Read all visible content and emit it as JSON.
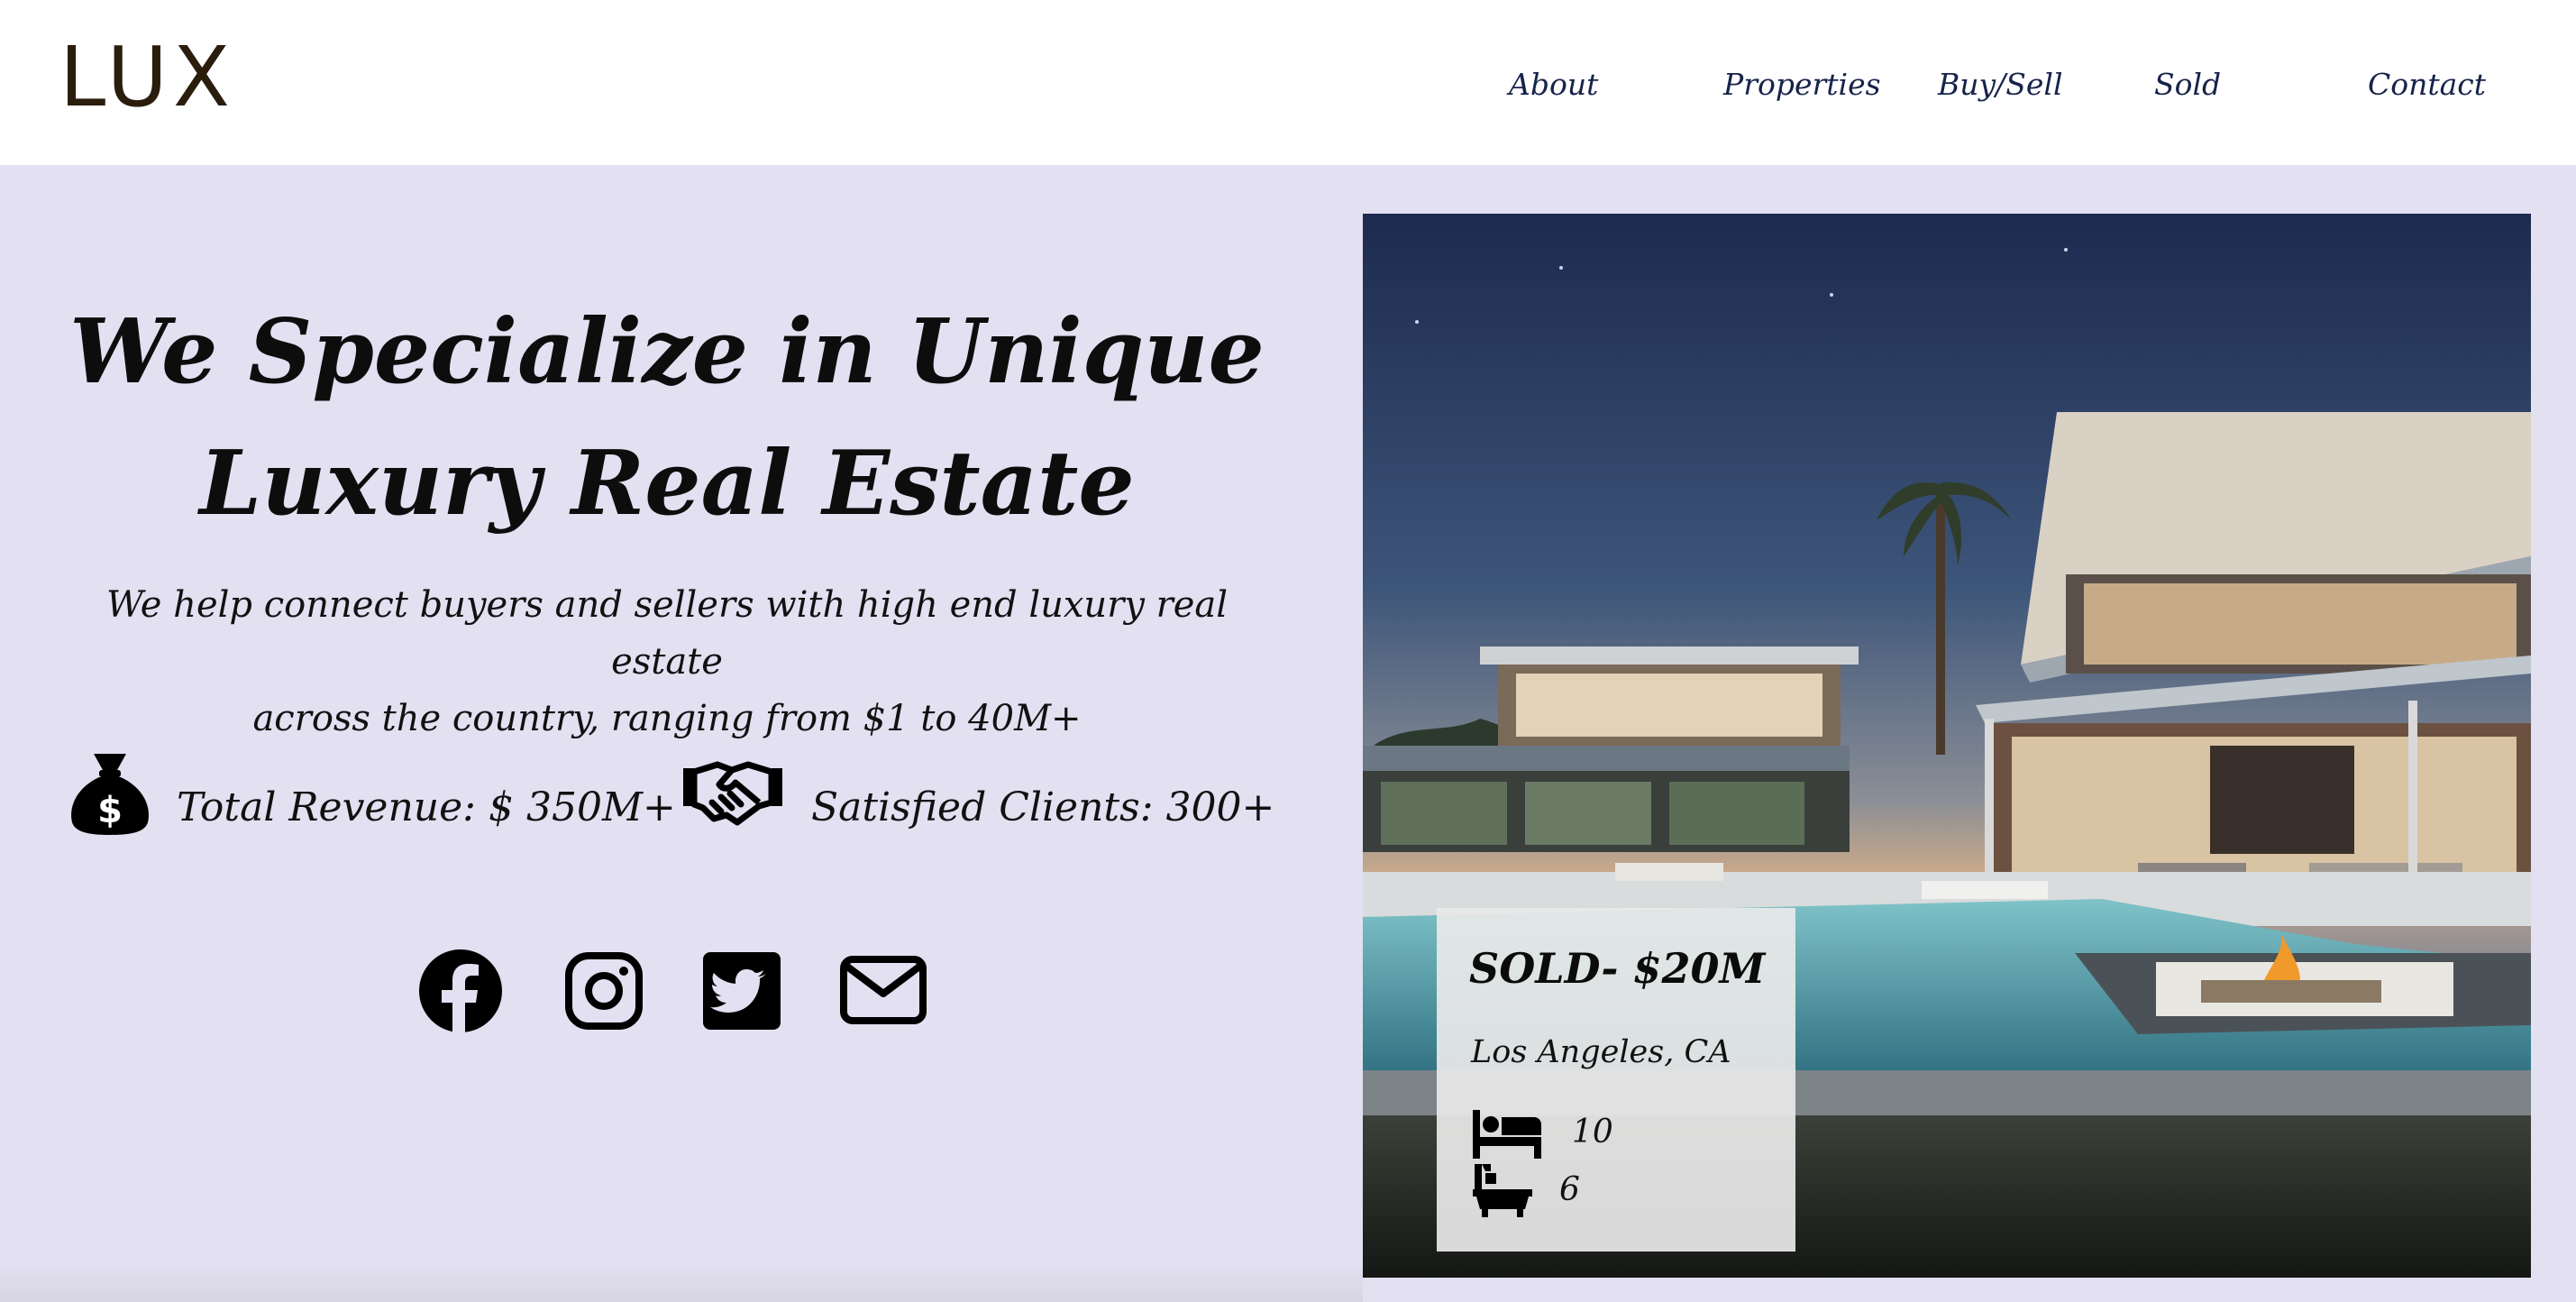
{
  "header": {
    "logo": "LUX",
    "nav": [
      {
        "label": "About"
      },
      {
        "label": "Properties"
      },
      {
        "label": "Buy/Sell"
      },
      {
        "label": "Sold"
      },
      {
        "label": "Contact"
      }
    ]
  },
  "hero": {
    "title_line1": "We Specialize in Unique",
    "title_line2": "Luxury Real Estate",
    "subtitle_line1": "We help connect buyers and sellers with high end luxury real estate",
    "subtitle_line2": "across the country, ranging from $1 to 40M+",
    "stats": [
      {
        "icon": "money-bag-icon",
        "label": "Total Revenue: $ 350M+"
      },
      {
        "icon": "handshake-icon",
        "label": "Satisfied Clients: 300+"
      }
    ],
    "social": [
      "facebook-icon",
      "instagram-icon",
      "twitter-icon",
      "email-icon"
    ]
  },
  "listing": {
    "price": "SOLD- $20M",
    "location": "Los Angeles, CA",
    "bedrooms": "10",
    "bathrooms": "6"
  },
  "colors": {
    "page_bg": "#e3e0f1",
    "header_bg": "#ffffff",
    "logo": "#2a1d0c",
    "nav_text": "#16234a",
    "text": "#111111"
  }
}
